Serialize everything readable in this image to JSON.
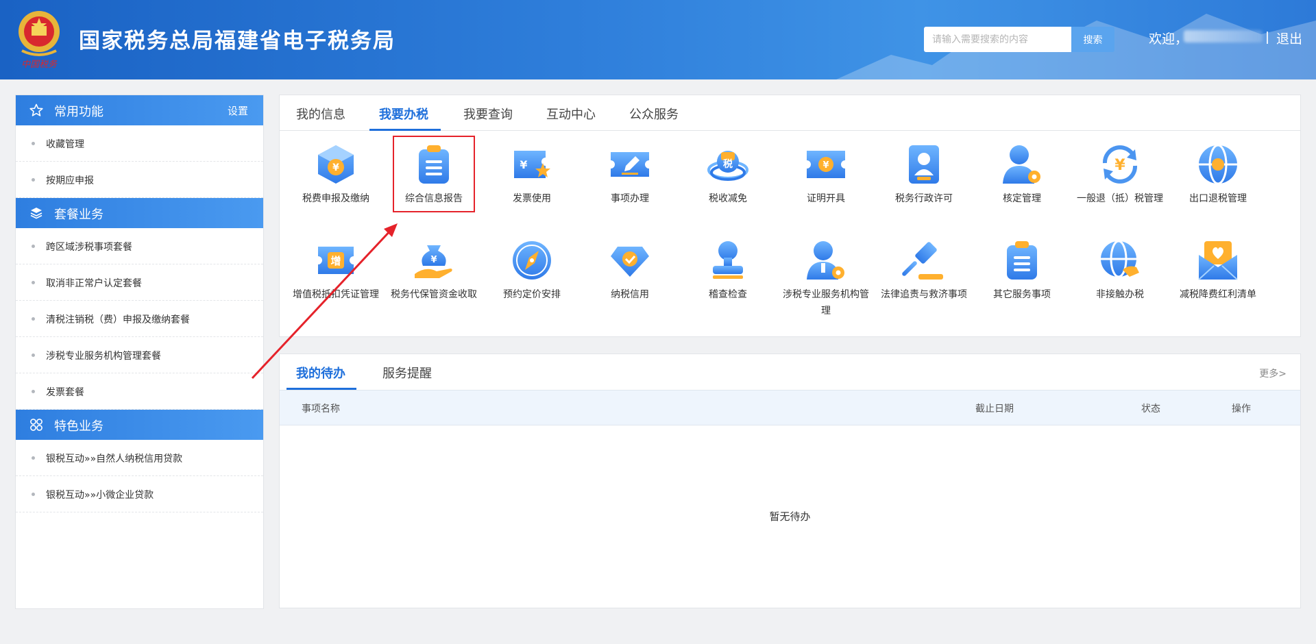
{
  "header": {
    "title": "国家税务总局福建省电子税务局",
    "emblem_caption": "中国税务",
    "search_placeholder": "请输入需要搜索的内容",
    "search_button": "搜索",
    "welcome": "欢迎，",
    "logout": "退出"
  },
  "sidebar": {
    "sections": [
      {
        "title": "常用功能",
        "icon": "star-icon",
        "action": "设置",
        "items": [
          "收藏管理",
          "按期应申报"
        ]
      },
      {
        "title": "套餐业务",
        "icon": "layers-icon",
        "items": [
          "跨区域涉税事项套餐",
          "取消非正常户认定套餐",
          "清税注销税（费）申报及缴纳套餐",
          "涉税专业服务机构管理套餐",
          "发票套餐"
        ]
      },
      {
        "title": "特色业务",
        "icon": "apps-icon",
        "items": [
          "银税互动»»自然人纳税信用贷款",
          "银税互动»»小微企业贷款"
        ]
      }
    ]
  },
  "service_panel": {
    "tabs": [
      "我的信息",
      "我要办税",
      "我要查询",
      "互动中心",
      "公众服务"
    ],
    "active_tab": "我要办税",
    "row1": [
      {
        "label": "税费申报及缴纳",
        "icon": "tax-box-icon"
      },
      {
        "label": "综合信息报告",
        "icon": "clipboard-icon"
      },
      {
        "label": "发票使用",
        "icon": "invoice-icon"
      },
      {
        "label": "事项办理",
        "icon": "edit-ticket-icon"
      },
      {
        "label": "税收减免",
        "icon": "tax-coin-icon"
      },
      {
        "label": "证明开具",
        "icon": "certificate-icon"
      },
      {
        "label": "税务行政许可",
        "icon": "license-icon"
      },
      {
        "label": "核定管理",
        "icon": "user-gear-icon"
      },
      {
        "label": "一般退（抵）税管理",
        "icon": "refund-icon"
      },
      {
        "label": "出口退税管理",
        "icon": "globe-icon"
      }
    ],
    "row2": [
      {
        "label": "增值税抵扣凭证管理",
        "icon": "vat-ticket-icon"
      },
      {
        "label": "税务代保管资金收取",
        "icon": "money-bag-icon"
      },
      {
        "label": "预约定价安排",
        "icon": "compass-icon"
      },
      {
        "label": "纳税信用",
        "icon": "diamond-icon"
      },
      {
        "label": "稽查检查",
        "icon": "stamp-icon"
      },
      {
        "label": "涉税专业服务机构管理",
        "icon": "agent-gear-icon"
      },
      {
        "label": "法律追责与救济事项",
        "icon": "gavel-icon"
      },
      {
        "label": "其它服务事项",
        "icon": "clipboard-list-icon"
      },
      {
        "label": "非接触办税",
        "icon": "globe-hand-icon"
      },
      {
        "label": "减税降费红利清单",
        "icon": "mail-heart-icon"
      }
    ],
    "highlighted_item": "综合信息报告"
  },
  "todo": {
    "tabs": [
      "我的待办",
      "服务提醒"
    ],
    "active_tab": "我的待办",
    "more": "更多>",
    "columns": [
      "事项名称",
      "截止日期",
      "状态",
      "操作"
    ],
    "empty_text": "暂无待办"
  },
  "colors": {
    "primary": "#1e6fdb",
    "header_start": "#1a62c4",
    "highlight_box": "#e5222a",
    "annotation_arrow": "#e5222a"
  }
}
